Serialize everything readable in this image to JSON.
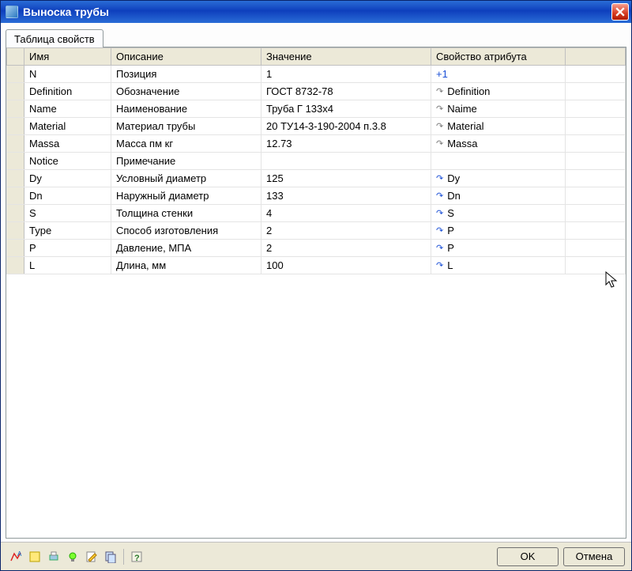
{
  "window": {
    "title": "Выноска трубы"
  },
  "tab": {
    "label": "Таблица свойств"
  },
  "columns": {
    "name": "Имя",
    "description": "Описание",
    "value": "Значение",
    "attr": "Свойство атрибута"
  },
  "rows": [
    {
      "name": "N",
      "desc": "Позиция",
      "value": "1",
      "attr": "+1",
      "attr_style": "link"
    },
    {
      "name": "Definition",
      "desc": "Обозначение",
      "value": "ГОСТ 8732-78",
      "attr": "Definition",
      "attr_style": "gray"
    },
    {
      "name": "Name",
      "desc": "Наименование",
      "value": "Труба Г 133х4",
      "attr": "Naime",
      "attr_style": "gray"
    },
    {
      "name": "Material",
      "desc": "Материал трубы",
      "value": "20 ТУ14-3-190-2004 п.3.8",
      "attr": "Material",
      "attr_style": "gray"
    },
    {
      "name": "Massa",
      "desc": "Масса пм кг",
      "value": "12.73",
      "attr": "Massa",
      "attr_style": "gray"
    },
    {
      "name": "Notice",
      "desc": "Примечание",
      "value": "",
      "attr": "",
      "attr_style": "none"
    },
    {
      "name": "Dy",
      "desc": "Условный диаметр",
      "value": "125",
      "attr": "Dy",
      "attr_style": "blue"
    },
    {
      "name": "Dn",
      "desc": "Наружный диаметр",
      "value": "133",
      "attr": "Dn",
      "attr_style": "blue"
    },
    {
      "name": "S",
      "desc": "Толщина стенки",
      "value": "4",
      "attr": "S",
      "attr_style": "blue"
    },
    {
      "name": "Type",
      "desc": "Способ изготовления",
      "value": "2",
      "attr": "P",
      "attr_style": "blue"
    },
    {
      "name": "P",
      "desc": "Давление, МПА",
      "value": "2",
      "attr": "P",
      "attr_style": "blue"
    },
    {
      "name": "L",
      "desc": "Длина, мм",
      "value": "100",
      "attr": "L",
      "attr_style": "blue"
    }
  ],
  "buttons": {
    "ok": "OK",
    "cancel": "Отмена"
  },
  "toolbar_icons": [
    "polyline-icon",
    "note-icon",
    "print-icon",
    "bulb-icon",
    "edit-icon",
    "copy-icon",
    "help-icon"
  ]
}
